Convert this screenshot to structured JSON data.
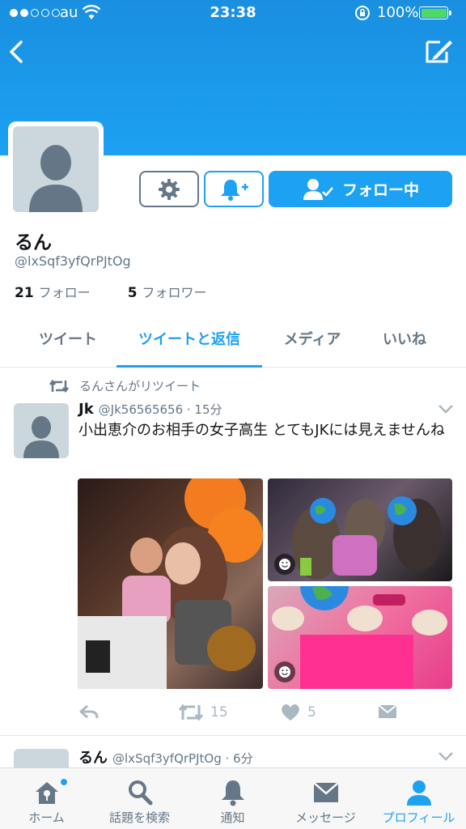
{
  "status_bar": {
    "carrier": "au",
    "time": "23:38",
    "battery": "100%",
    "signal_bars": 2
  },
  "profile": {
    "name": "るん",
    "handle": "@lxSqf3yfQrPJtOg",
    "following_count": "21",
    "following_label": "フォロー",
    "followers_count": "5",
    "followers_label": "フォロワー",
    "follow_button_label": "フォロー中"
  },
  "tabs": [
    {
      "label": "ツイート",
      "active": false
    },
    {
      "label": "ツイートと返信",
      "active": true
    },
    {
      "label": "メディア",
      "active": false
    },
    {
      "label": "いいね",
      "active": false
    }
  ],
  "tweets": [
    {
      "retweet_label": "るんさんがリツイート",
      "author_name": "Jk",
      "author_handle": "@Jk56565656 · 15分",
      "text": "小出恵介のお相手の女子高生 とてもJKには見えませんね",
      "retweets": "15",
      "likes": "5"
    },
    {
      "author_name": "るん",
      "author_handle": "@lxSqf3yfQrPJtOg · 6分"
    }
  ],
  "tabbar": [
    {
      "label": "ホーム",
      "icon": "home-icon",
      "active": false
    },
    {
      "label": "話題を検索",
      "icon": "search-icon",
      "active": false
    },
    {
      "label": "通知",
      "icon": "bell-icon",
      "active": false
    },
    {
      "label": "メッセージ",
      "icon": "envelope-icon",
      "active": false
    },
    {
      "label": "プロフィール",
      "icon": "person-icon",
      "active": true
    }
  ],
  "colors": {
    "accent": "#1da1f2",
    "muted": "#657786",
    "icon_grey": "#aab8c2"
  }
}
